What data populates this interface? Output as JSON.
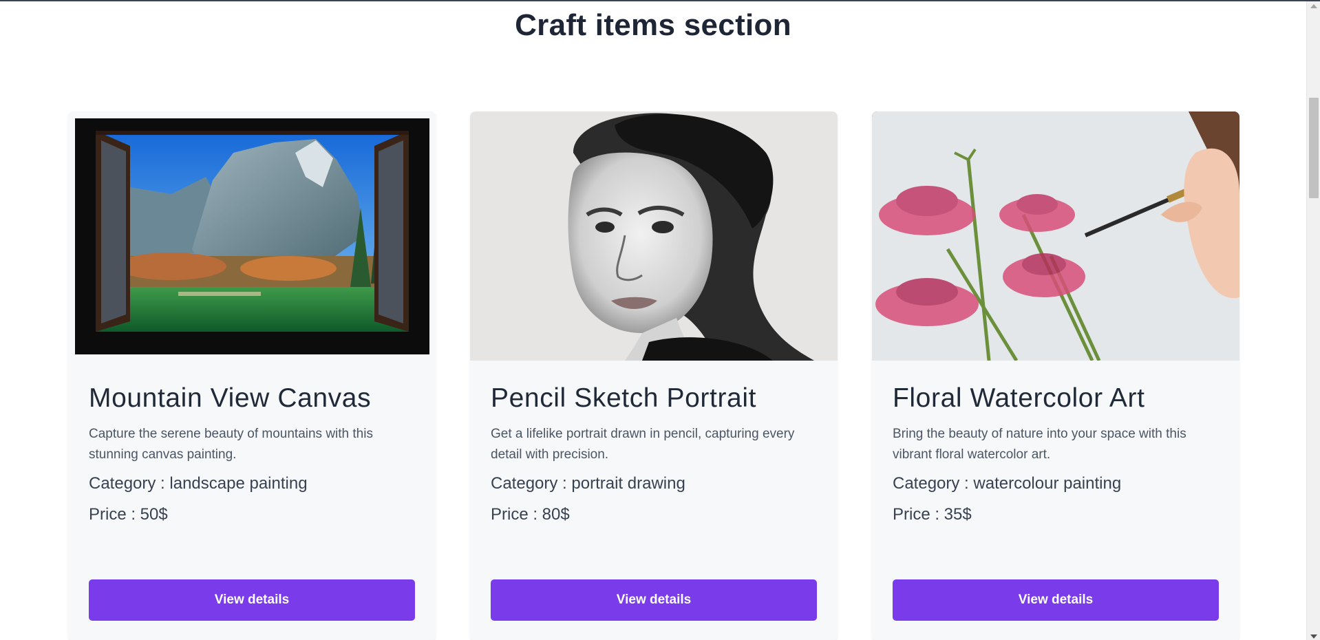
{
  "section": {
    "title": "Craft items section"
  },
  "cards": [
    {
      "image_icon": "mountain-landscape-window-image",
      "title": "Mountain View Canvas",
      "description": "Capture the serene beauty of mountains with this stunning canvas painting.",
      "category": "Category : landscape painting",
      "price": "Price : 50$",
      "button_label": "View details"
    },
    {
      "image_icon": "pencil-portrait-image",
      "title": "Pencil Sketch Portrait",
      "description": "Get a lifelike portrait drawn in pencil, capturing every detail with precision.",
      "category": "Category : portrait drawing",
      "price": "Price : 80$",
      "button_label": "View details"
    },
    {
      "image_icon": "floral-watercolor-image",
      "title": "Floral Watercolor Art",
      "description": "Bring the beauty of nature into your space with this vibrant floral watercolor art.",
      "category": "Category : watercolour painting",
      "price": "Price : 35$",
      "button_label": "View details"
    }
  ],
  "colors": {
    "accent": "#7a3cea",
    "title": "#1e2535",
    "card_bg": "#f7f8fa"
  }
}
